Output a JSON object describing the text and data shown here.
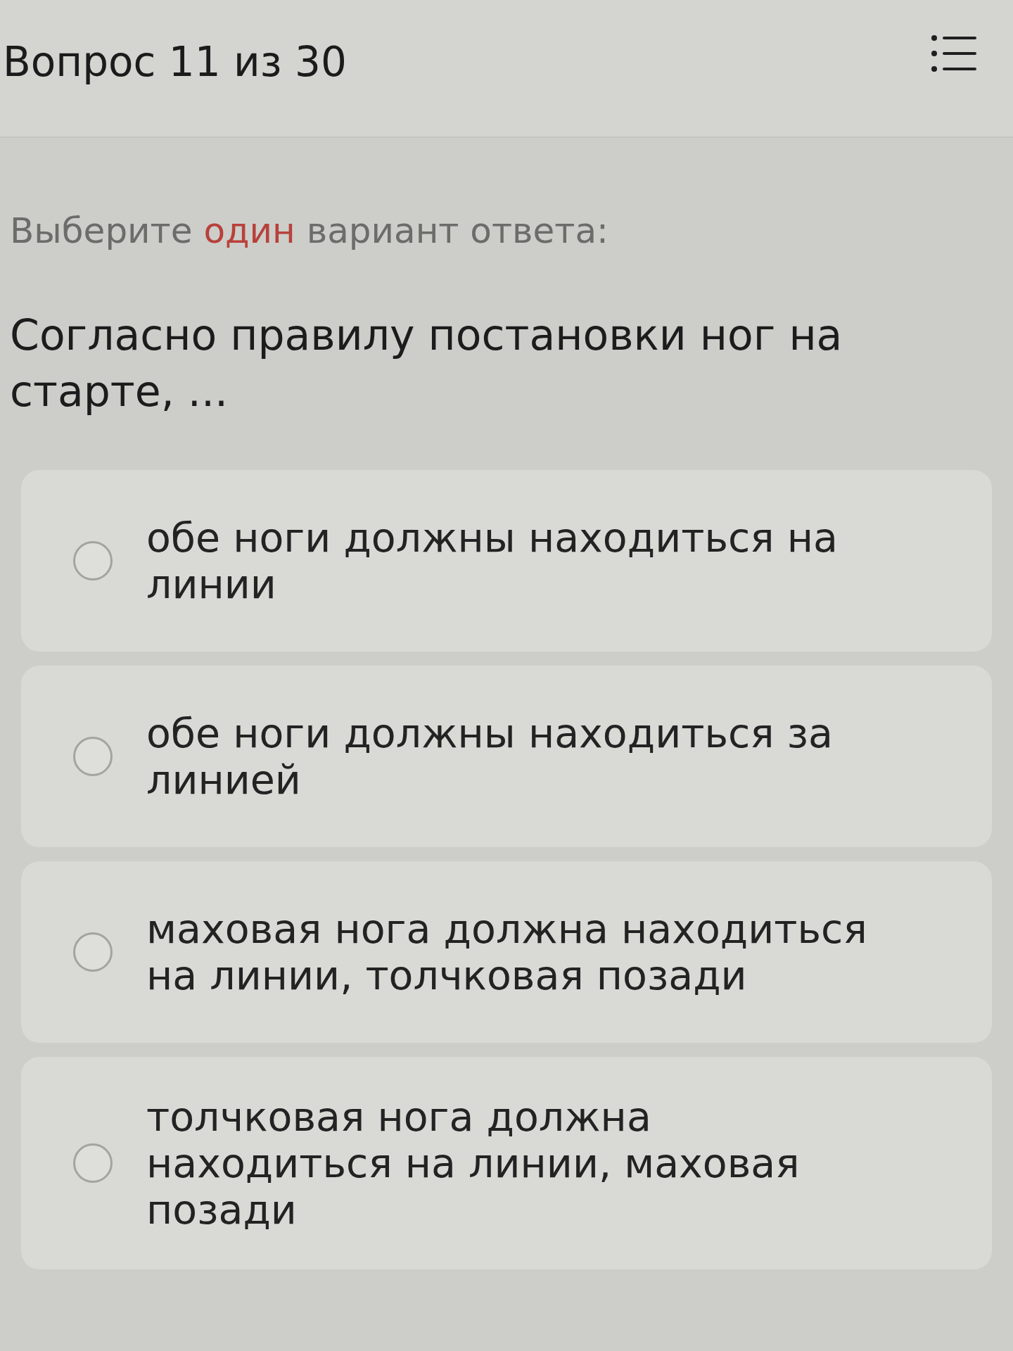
{
  "header": {
    "title": "Вопрос 11 из 30"
  },
  "instruction": {
    "before": "Выберите",
    "emphasis": "один",
    "after": "вариант ответа:"
  },
  "question": "Согласно правилу постановки ног на старте, ...",
  "options": [
    {
      "label": "обе ноги должны находиться на линии",
      "selected": false
    },
    {
      "label": "обе ноги должны находиться за линией",
      "selected": false
    },
    {
      "label": "маховая нога должна находиться на линии, толчковая позади",
      "selected": false
    },
    {
      "label": "толчковая нога должна находиться на линии, маховая позади",
      "selected": false
    }
  ]
}
